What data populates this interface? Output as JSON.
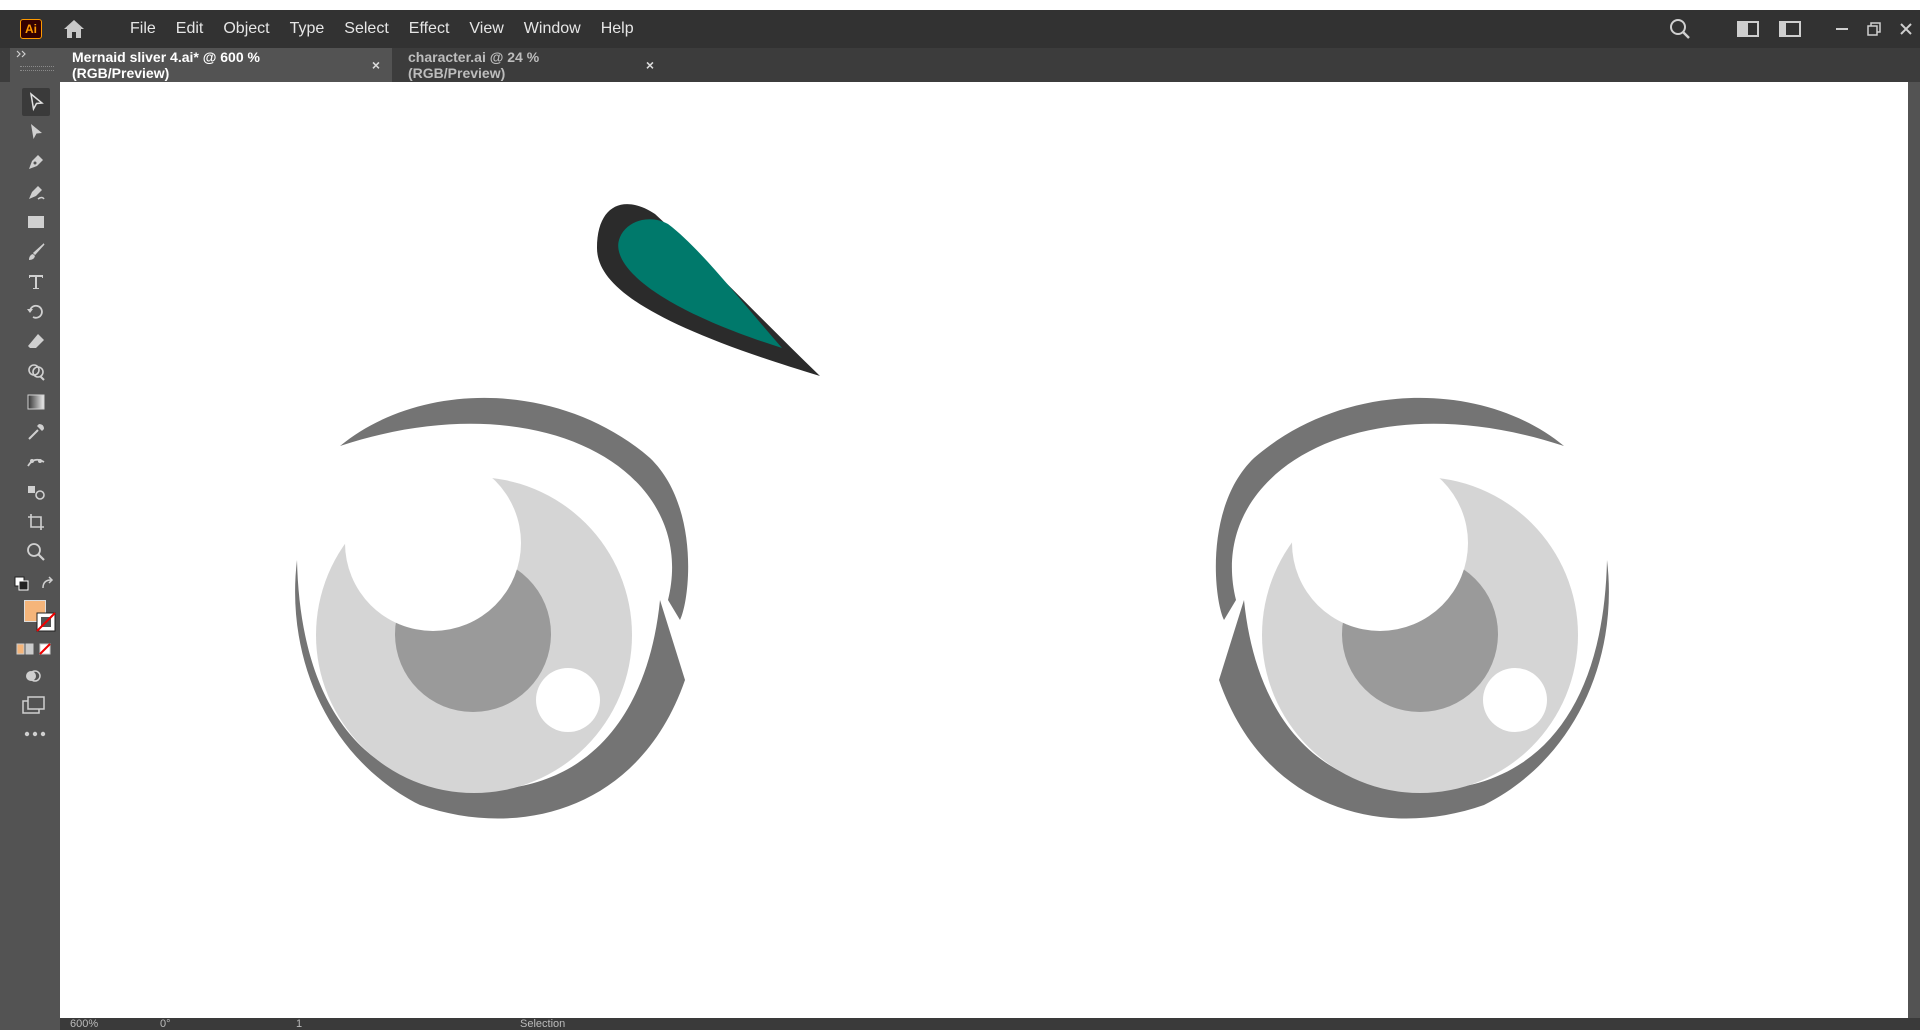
{
  "app": {
    "logo_text": "Ai"
  },
  "menu": {
    "items": [
      "File",
      "Edit",
      "Object",
      "Type",
      "Select",
      "Effect",
      "View",
      "Window",
      "Help"
    ]
  },
  "tabs": [
    {
      "label": "Mernaid sliver 4.ai* @ 600 % (RGB/Preview)",
      "close": "×",
      "active": true
    },
    {
      "label": "character.ai @ 24 % (RGB/Preview)",
      "close": "×",
      "active": false
    }
  ],
  "status": {
    "zoom": "600%",
    "rotation": "0°",
    "page": "1",
    "tool": "Selection"
  },
  "colors": {
    "fill_swatch": "#f5b57a",
    "leaf_fill": "#00796b",
    "leaf_stroke": "#2b2b2b",
    "eye_outer": "#747474",
    "iris": "#d5d5d5",
    "pupil": "#9a9a9a"
  },
  "icons": {
    "toolbar": [
      "selection-tool-icon",
      "direct-selection-tool-icon",
      "pen-tool-icon",
      "curvature-tool-icon",
      "rectangle-tool-icon",
      "paintbrush-tool-icon",
      "type-tool-icon",
      "rotate-tool-icon",
      "eraser-tool-icon",
      "shape-builder-icon",
      "gradient-tool-icon",
      "eyedropper-tool-icon",
      "puppet-warp-icon",
      "blend-tool-icon",
      "artboard-tool-icon",
      "zoom-tool-icon"
    ]
  }
}
